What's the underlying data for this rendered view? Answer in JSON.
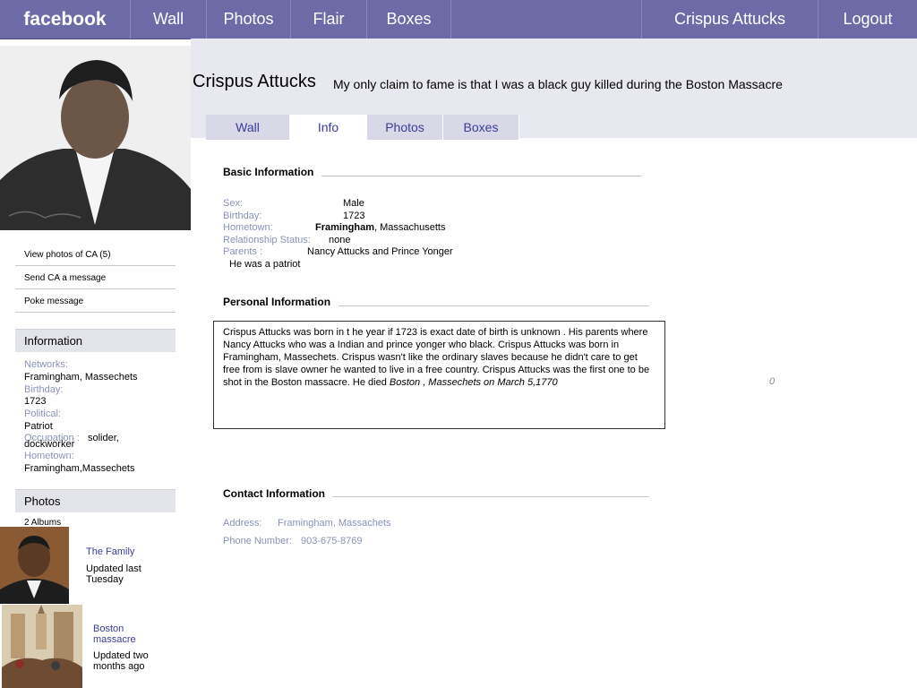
{
  "topbar": {
    "brand": "facebook",
    "nav": [
      "Wall",
      "Photos",
      "Flair",
      "Boxes"
    ],
    "user": "Crispus Attucks",
    "logout": "Logout"
  },
  "profile": {
    "name": "Crispus Attucks",
    "status": "My only claim to fame is that I was a black guy killed during the Boston Massacre",
    "tabs": [
      "Wall",
      "Info",
      "Photos",
      "Boxes"
    ],
    "active_tab": "Info"
  },
  "sidebar": {
    "links": [
      "View photos of CA (5)",
      "Send CA a message",
      "Poke message"
    ],
    "information": {
      "heading": "Information",
      "networks_label": "Networks:",
      "networks_value": "Framingham, Massechets",
      "birthday_label": "Birthday:",
      "birthday_value": "1723",
      "political_label": "Political:",
      "political_value": "Patriot",
      "occupation_label": "Occupation :",
      "occupation_value_1": "solider,",
      "occupation_value_2": "dockworker",
      "hometown_label": "Hometown:",
      "hometown_value": "Framingham,Massechets"
    },
    "photos": {
      "heading": "Photos",
      "albums_count": "2 Albums",
      "albums": [
        {
          "title": "The Family",
          "updated": "Updated last Tuesday"
        },
        {
          "title": "Boston massacre",
          "updated": "Updated two months ago"
        }
      ]
    }
  },
  "basic_info": {
    "title": "Basic Information",
    "sex_label": "Sex:",
    "sex_value": "Male",
    "birthday_label": "Birthday:",
    "birthday_value": "1723",
    "hometown_label": "Hometown:",
    "hometown_bold": "Framingham",
    "hometown_rest": ", Massachusetts",
    "relationship_label": "Relationship Status:",
    "relationship_value": "none",
    "parents_label": "Parents :",
    "parents_value": "Nancy Attucks and Prince Yonger",
    "extra_line": "He was a patriot"
  },
  "personal_info": {
    "title": "Personal Information",
    "bio_text": "Crispus  Attucks was born  in t he year if 1723 is exact date of birth is unknown . His parents where Nancy Attucks who was a Indian  and prince yonger who  black.  Crispus Attucks was born in  Framingham, Massechets.  Crispus  wasn't like the ordinary slaves because he didn't care to get free from is slave owner he wanted  to live in a free country. Crispus Attucks was the first one to be shot in the Boston massacre. He died ",
    "bio_italic": "Boston , Massechets on March 5,1770",
    "counter": "0"
  },
  "contact_info": {
    "title": "Contact Information",
    "address_label": "Address:",
    "address_value": "Framingham, Massachets",
    "phone_label": "Phone Number:",
    "phone_value": "903-675-8769"
  }
}
